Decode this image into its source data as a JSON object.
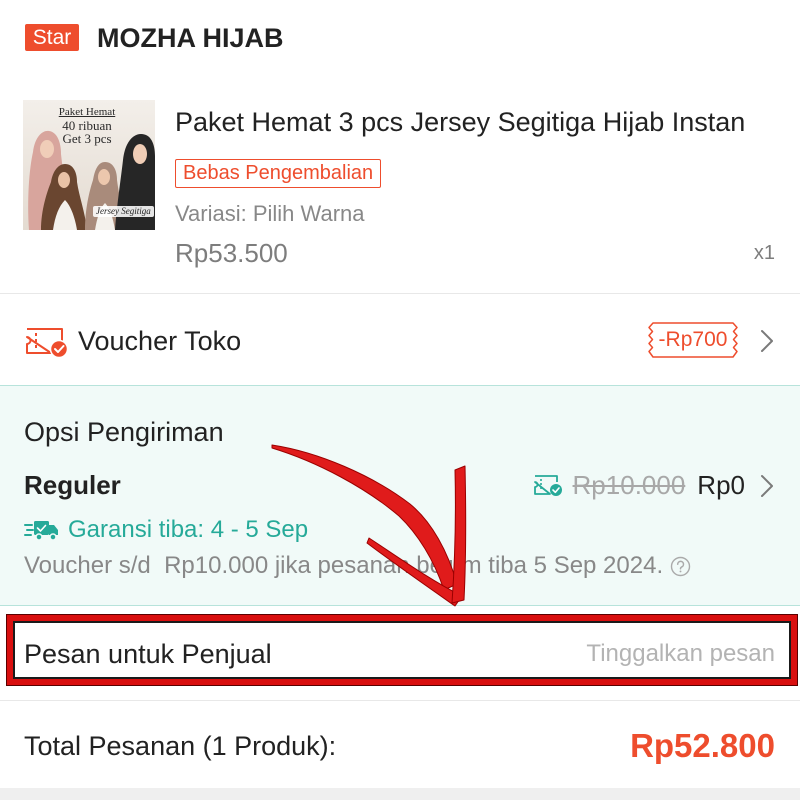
{
  "shop": {
    "badge": "Star",
    "name": "MOZHA HIJAB"
  },
  "product": {
    "image_text": {
      "line1": "Paket Hemat",
      "line2": "40 ribuan",
      "line3": "Get 3 pcs",
      "caption": "Jersey Segitiga"
    },
    "title": "Paket Hemat 3 pcs Jersey Segitiga Hijab Instan",
    "badge": "Bebas Pengembalian",
    "variation": "Variasi: Pilih Warna",
    "price": "Rp53.500",
    "quantity": "x1"
  },
  "voucher": {
    "label": "Voucher Toko",
    "discount": "-Rp700"
  },
  "shipping": {
    "title": "Opsi Pengiriman",
    "method": "Reguler",
    "original_price": "Rp10.000",
    "price": "Rp0",
    "guarantee": "Garansi tiba: 4 - 5 Sep",
    "voucher_note": "Voucher s/d  Rp10.000 jika pesanan belum tiba 5 Sep 2024."
  },
  "message": {
    "label": "Pesan untuk Penjual",
    "placeholder": "Tinggalkan pesan"
  },
  "total": {
    "label": "Total Pesanan (1 Produk):",
    "amount": "Rp52.800"
  },
  "colors": {
    "accent": "#ee4d2d",
    "teal": "#26aa99",
    "ship_bg": "#f1faf8",
    "muted": "#888888",
    "annotation": "#d90f0f"
  },
  "icons": {
    "voucher": "shop-voucher-icon",
    "chevron": "chevron-right-icon",
    "shipping_voucher": "shipping-voucher-icon",
    "truck": "truck-icon",
    "help": "question-circle-icon"
  }
}
